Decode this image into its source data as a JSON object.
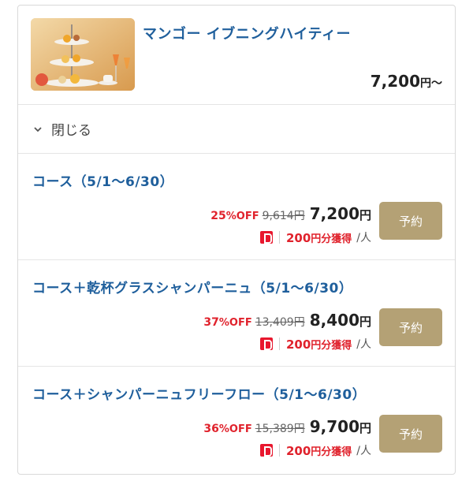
{
  "plan": {
    "title": "マンゴー イブニングハイティー",
    "price_num": "7,200",
    "price_unit": "円〜"
  },
  "toggle": {
    "label": "閉じる",
    "icon": "chevron-down-icon"
  },
  "courses": [
    {
      "title": "コース（5/1〜6/30）",
      "discount_num": "25",
      "discount_suffix": "%OFF",
      "original_price": "9,614円",
      "price_num": "7,200",
      "price_unit": "円",
      "points_num": "200",
      "points_suffix": "円分獲得",
      "per": "/人",
      "button": "予約"
    },
    {
      "title": "コース＋乾杯グラスシャンパーニュ（5/1〜6/30）",
      "discount_num": "37",
      "discount_suffix": "%OFF",
      "original_price": "13,409円",
      "price_num": "8,400",
      "price_unit": "円",
      "points_num": "200",
      "points_suffix": "円分獲得",
      "per": "/人",
      "button": "予約"
    },
    {
      "title": "コース＋シャンパーニュフリーフロー（5/1〜6/30）",
      "discount_num": "36",
      "discount_suffix": "%OFF",
      "original_price": "15,389円",
      "price_num": "9,700",
      "price_unit": "円",
      "points_num": "200",
      "points_suffix": "円分獲得",
      "per": "/人",
      "button": "予約"
    }
  ],
  "colors": {
    "title_blue": "#1f5f9c",
    "discount_red": "#e0222c",
    "button_gold": "#b4a175",
    "paypay_red": "#e8172e"
  }
}
